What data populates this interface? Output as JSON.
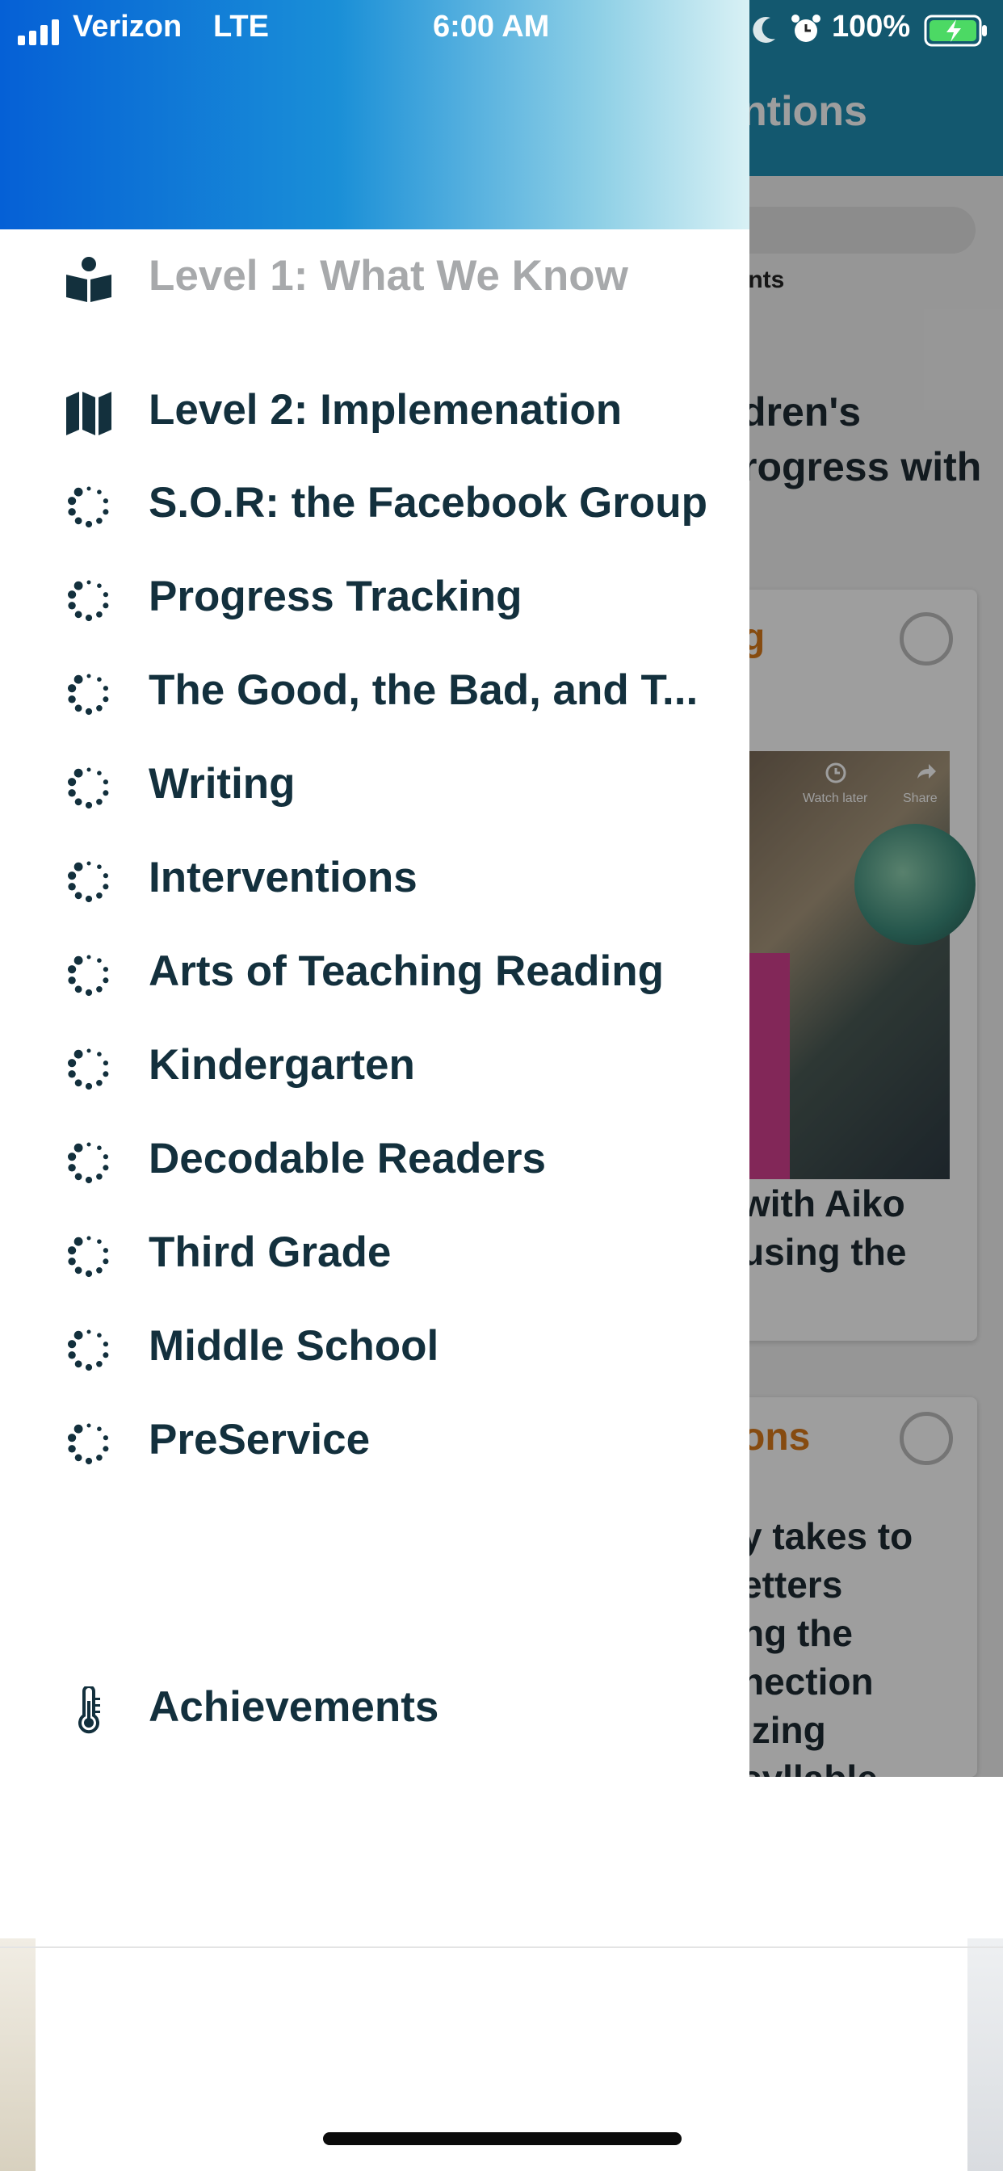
{
  "status_bar": {
    "carrier": "Verizon",
    "network": "LTE",
    "time": "6:00 AM",
    "battery_percent": "100%",
    "icons": [
      "signal-bars-icon",
      "moon-icon",
      "alarm-clock-icon",
      "battery-charging-icon"
    ]
  },
  "background_screen": {
    "title_fragment": "ntions",
    "points_fragment": "ints",
    "heading_lines": [
      "dren's",
      "rogress with"
    ],
    "card1": {
      "title_fragment": "g",
      "video": {
        "watch_later": "Watch later",
        "share": "Share"
      },
      "body_lines": [
        "with Aiko",
        "using the"
      ]
    },
    "card2": {
      "title_fragment": "ons",
      "body_lines": [
        "y takes to",
        "etters",
        "ng the",
        "nection",
        "izing",
        "syllable"
      ]
    }
  },
  "drawer": {
    "items": [
      {
        "label": "Level 1: What We Know",
        "icon": "reader-book-icon",
        "disabled": true
      },
      {
        "label": "Level 2: Implemenation",
        "icon": "map-icon"
      },
      {
        "label": "S.O.R: the Facebook Group",
        "icon": "spinner-dots-icon"
      },
      {
        "label": "Progress Tracking",
        "icon": "spinner-dots-icon"
      },
      {
        "label": "The Good, the Bad, and T...",
        "icon": "spinner-dots-icon"
      },
      {
        "label": "Writing",
        "icon": "spinner-dots-icon"
      },
      {
        "label": "Interventions",
        "icon": "spinner-dots-icon"
      },
      {
        "label": "Arts of Teaching Reading",
        "icon": "spinner-dots-icon"
      },
      {
        "label": "Kindergarten",
        "icon": "spinner-dots-icon"
      },
      {
        "label": "Decodable Readers",
        "icon": "spinner-dots-icon"
      },
      {
        "label": "Third Grade",
        "icon": "spinner-dots-icon"
      },
      {
        "label": "Middle School",
        "icon": "spinner-dots-icon"
      },
      {
        "label": "PreService",
        "icon": "spinner-dots-icon"
      }
    ],
    "footer_item": {
      "label": "Achievements",
      "icon": "thermometer-icon"
    }
  },
  "colors": {
    "header_gradient_start": "#0560d6",
    "header_gradient_end": "#d9f1f5",
    "menu_text": "#13303d",
    "menu_text_disabled": "#a7a9ab",
    "accent_orange": "#d9791a"
  }
}
